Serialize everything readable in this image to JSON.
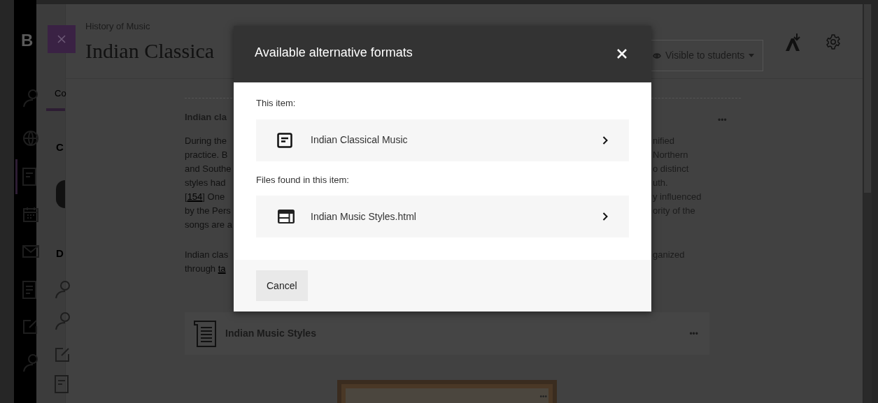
{
  "logo_letter": "B",
  "course": {
    "breadcrumb": "History of Music",
    "title": "Indian Classica"
  },
  "visibility": {
    "label": "Visible to students"
  },
  "side_panel": {
    "tab": "Co",
    "heading_1": "C",
    "heading_2": "D"
  },
  "article": {
    "heading": "Indian cla",
    "menu": "•••",
    "rows": [
      {
        "segments": [
          {
            "text": "During the",
            "link": false
          }
        ],
        "right": "nified"
      },
      {
        "segments": [
          {
            "text": "practice. B",
            "link": false
          }
        ],
        "right": "Northern"
      },
      {
        "segments": [
          {
            "text": "and Southe",
            "link": false
          }
        ],
        "right": "o distinct"
      },
      {
        "segments": [
          {
            "text": "styles had",
            "link": false
          }
        ],
        "right": "uth."
      },
      {
        "segments": [
          {
            "text": "[",
            "link": false
          },
          {
            "text": "154",
            "link": true
          },
          {
            "text": "] One",
            "link": false
          }
        ],
        "right": "y influenced"
      },
      {
        "segments": [
          {
            "text": "by the Pers",
            "link": false
          }
        ],
        "right": "ority of the"
      },
      {
        "segments": [
          {
            "text": "songs are a",
            "link": false
          }
        ]
      }
    ],
    "rows_2": [
      {
        "segments": [
          {
            "text": "Indian clas",
            "link": false
          }
        ],
        "right": "ganized"
      },
      {
        "segments": [
          {
            "text": "through ",
            "link": false
          },
          {
            "text": "ta",
            "link": true
          }
        ]
      }
    ]
  },
  "file_card": {
    "title": "Indian Music Styles",
    "menu": "•••"
  },
  "image_menu": "•••",
  "modal": {
    "title": "Available alternative formats",
    "sections": [
      {
        "label": "This item:",
        "items": [
          {
            "kind": "document",
            "name": "Indian Classical Music"
          }
        ]
      },
      {
        "label": "Files found in this item:",
        "items": [
          {
            "kind": "webpage",
            "name": "Indian Music Styles.html"
          }
        ]
      }
    ],
    "cancel": "Cancel"
  }
}
